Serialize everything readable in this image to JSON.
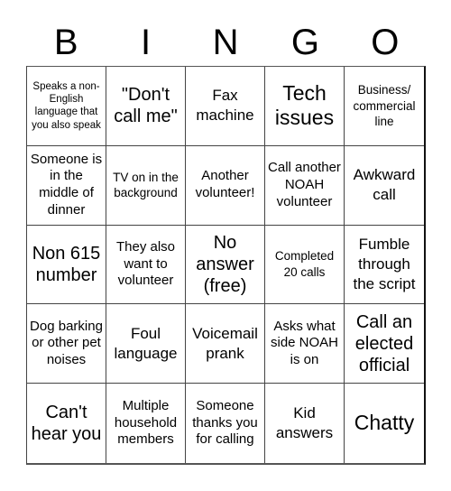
{
  "header": {
    "letters": [
      "B",
      "I",
      "N",
      "G",
      "O"
    ]
  },
  "cells": [
    {
      "text": "Speaks a non-English language that you also speak"
    },
    {
      "text": "\"Don't call me\""
    },
    {
      "text": "Fax machine"
    },
    {
      "text": "Tech issues"
    },
    {
      "text": "Business/ commercial line"
    },
    {
      "text": "Someone is in the middle of dinner"
    },
    {
      "text": "TV on in the background"
    },
    {
      "text": "Another volunteer!"
    },
    {
      "text": "Call another NOAH volunteer"
    },
    {
      "text": "Awkward call"
    },
    {
      "text": "Non 615 number"
    },
    {
      "text": "They also want to volunteer"
    },
    {
      "text": "No answer (free)"
    },
    {
      "text": "Completed 20 calls"
    },
    {
      "text": "Fumble through the script"
    },
    {
      "text": "Dog barking or other pet noises"
    },
    {
      "text": "Foul language"
    },
    {
      "text": "Voicemail prank"
    },
    {
      "text": "Asks what side NOAH is on"
    },
    {
      "text": "Call an elected official"
    },
    {
      "text": "Can't hear you"
    },
    {
      "text": "Multiple household members"
    },
    {
      "text": "Someone thanks you for calling"
    },
    {
      "text": "Kid answers"
    },
    {
      "text": "Chatty"
    }
  ]
}
